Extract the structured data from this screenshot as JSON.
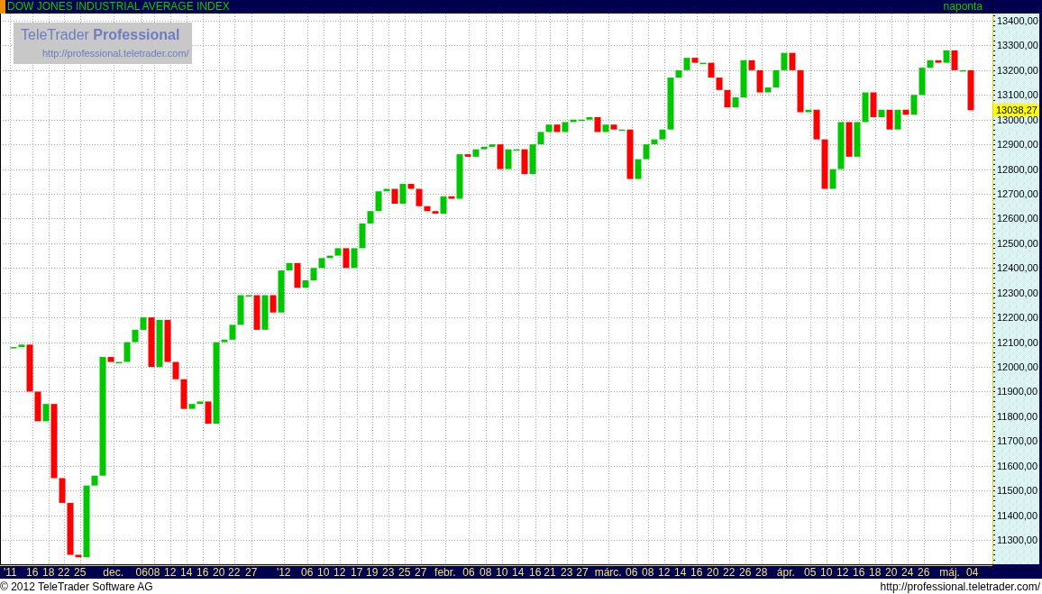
{
  "header": {
    "title": "DOW JONES INDUSTRIAL AVERAGE INDEX",
    "interval": "naponta"
  },
  "logo": {
    "name": "TeleTrader **Professional**",
    "url": "http://professional.teletrader.com/"
  },
  "chart": {
    "price_tag": "13038,27",
    "price_axis": [
      "13400,00",
      "13300,00",
      "13200,00",
      "13100,00",
      "13000,00",
      "12900,00",
      "12800,00",
      "12700,00",
      "12600,00",
      "12500,00",
      "12400,00",
      "12300,00",
      "12200,00",
      "12100,00",
      "12000,00",
      "11900,00",
      "11800,00",
      "11700,00",
      "11600,00",
      "11500,00",
      "11400,00",
      "11300,00"
    ],
    "date_axis": [
      "'11",
      "16",
      "18",
      "22",
      "25",
      "dec.",
      "06",
      "08",
      "12",
      "14",
      "16",
      "20",
      "22",
      "27",
      "'12",
      "06",
      "10",
      "12",
      "17",
      "19",
      "23",
      "25",
      "27",
      "febr.",
      "06",
      "08",
      "10",
      "14",
      "16",
      "21",
      "23",
      "27",
      "márc.",
      "06",
      "08",
      "12",
      "14",
      "16",
      "20",
      "22",
      "26",
      "28",
      "ápr.",
      "05",
      "10",
      "12",
      "16",
      "18",
      "20",
      "24",
      "26",
      "máj.",
      "04"
    ]
  },
  "footer": {
    "copyright": "© 2012 TeleTrader Software AG",
    "url": "http://professional.teletrader.com/"
  }
}
